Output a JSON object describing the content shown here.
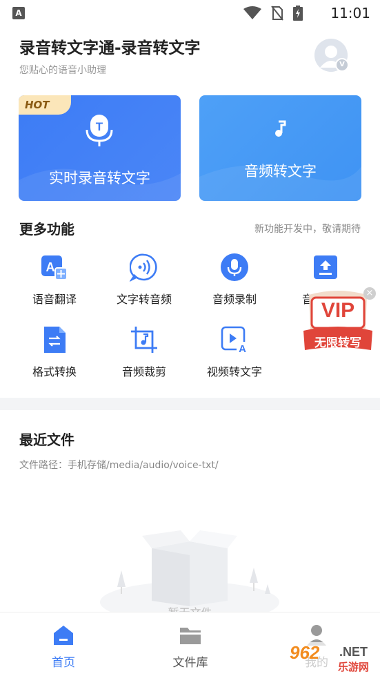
{
  "status_bar": {
    "app_icon_letter": "A",
    "time": "11:01",
    "icons": [
      "wifi-icon",
      "no-sim-icon",
      "battery-charging-icon"
    ]
  },
  "header": {
    "title": "录音转文字通-录音转文字",
    "subtitle": "您贴心的语音小助理",
    "avatar_badge": "V"
  },
  "cards": {
    "realtime": {
      "label": "实时录音转文字",
      "badge": "HOT",
      "icon": "microphone-t-icon"
    },
    "audio": {
      "label": "音频转文字",
      "icon": "music-note-icon"
    }
  },
  "more": {
    "title": "更多功能",
    "hint": "新功能开发中，敬请期待",
    "items": [
      {
        "label": "语音翻译",
        "icon": "translate-icon"
      },
      {
        "label": "文字转音频",
        "icon": "speech-bubble-icon"
      },
      {
        "label": "音频录制",
        "icon": "microphone-icon"
      },
      {
        "label": "音",
        "icon": "upload-icon"
      },
      {
        "label": "格式转换",
        "icon": "format-convert-icon"
      },
      {
        "label": "音频裁剪",
        "icon": "crop-audio-icon"
      },
      {
        "label": "视频转文字",
        "icon": "video-to-text-icon"
      }
    ]
  },
  "vip": {
    "title": "VIP",
    "subtitle": "无限转写"
  },
  "recent": {
    "title": "最近文件",
    "path": "文件路径：手机存储/media/audio/voice-txt/",
    "empty_text": "暂无文件"
  },
  "nav": {
    "items": [
      {
        "label": "首页",
        "icon": "home-icon",
        "active": true
      },
      {
        "label": "文件库",
        "icon": "folder-icon",
        "active": false
      },
      {
        "label": "我的",
        "icon": "user-icon",
        "active": false
      }
    ]
  },
  "watermark": {
    "number": "962",
    "suffix": ".NET",
    "site": "乐游网"
  },
  "colors": {
    "primary": "#3d7cf5",
    "secondary": "#4ea0f7",
    "hot_badge": "#fbe6b9",
    "vip_red": "#e0453a"
  }
}
